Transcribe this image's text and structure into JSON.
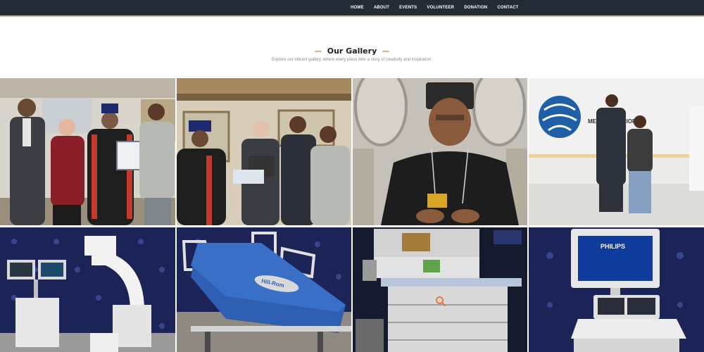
{
  "nav": {
    "items": [
      "HOME",
      "ABOUT",
      "EVENTS",
      "VOLUNTEER",
      "DONATION",
      "CONTACT"
    ]
  },
  "gallery": {
    "title": "Our Gallery",
    "subtitle": "Explore our vibrant gallery, where every piece tells a story of creativity and inspiration."
  },
  "tiles": [
    {
      "name": "photo-award-group",
      "icon": "photo"
    },
    {
      "name": "photo-certificate-presentation",
      "icon": "photo"
    },
    {
      "name": "photo-clergy-portrait",
      "icon": "photo"
    },
    {
      "name": "photo-office-visit",
      "icon": "photo",
      "sign_text": "MEDICAL ETHIOPIA"
    },
    {
      "name": "photo-c-arm-xray",
      "icon": "photo"
    },
    {
      "name": "photo-hospital-bed",
      "icon": "photo",
      "brand_text": "Hill-Rom"
    },
    {
      "name": "photo-anesthesia-machine",
      "icon": "photo"
    },
    {
      "name": "photo-ultrasound-machine",
      "icon": "photo",
      "brand_text": "PHILIPS"
    }
  ],
  "colors": {
    "topbar": "#222b36",
    "accent": "#e1b195",
    "backdrop_blue": "#1f2a5e"
  },
  "overlay": {
    "icon": "search-icon"
  }
}
